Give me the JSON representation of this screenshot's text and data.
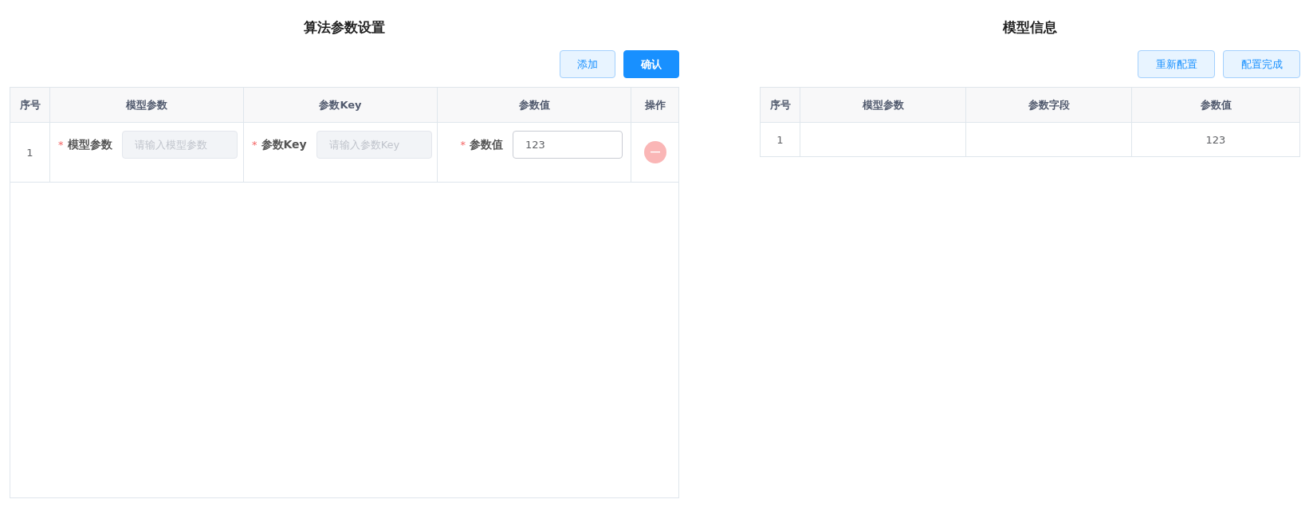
{
  "left_panel": {
    "title": "算法参数设置",
    "buttons": [
      {
        "label": "添加",
        "kind": "plain"
      },
      {
        "label": "确认",
        "kind": "primary"
      }
    ],
    "table": {
      "columns": [
        "序号",
        "模型参数",
        "参数Key",
        "参数值",
        "操作"
      ],
      "rows": [
        {
          "index": "1",
          "fields": [
            {
              "required_mark": "*",
              "label": "模型参数",
              "placeholder": "请输入模型参数",
              "disabled": true
            },
            {
              "required_mark": "*",
              "label": "参数Key",
              "placeholder": "请输入参数Key",
              "disabled": true
            },
            {
              "required_mark": "*",
              "label": "参数值",
              "value": "123",
              "disabled": false
            }
          ]
        }
      ]
    }
  },
  "right_panel": {
    "title": "模型信息",
    "buttons": [
      {
        "label": "重新配置",
        "kind": "plain"
      },
      {
        "label": "配置完成",
        "kind": "plain"
      }
    ],
    "table": {
      "columns": [
        "序号",
        "模型参数",
        "参数字段",
        "参数值"
      ],
      "rows": [
        [
          "1",
          "",
          "",
          "123"
        ]
      ]
    }
  }
}
